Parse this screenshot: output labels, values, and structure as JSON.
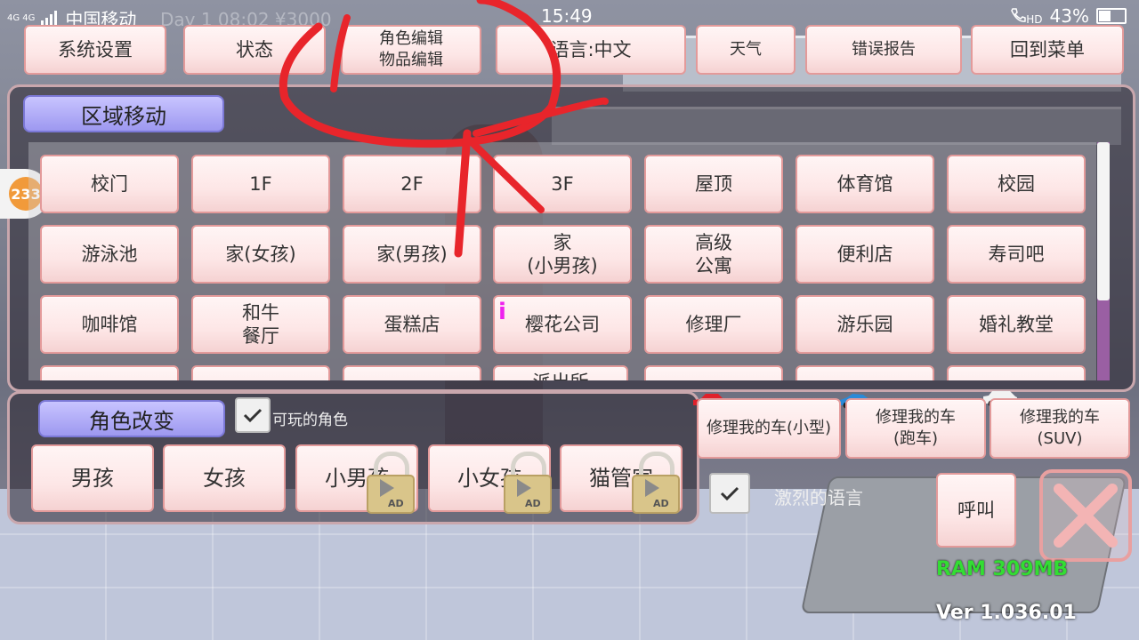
{
  "statusbar": {
    "network": "4G 4G",
    "carrier": "中国移动",
    "time": "15:49",
    "hd": "HD",
    "battery": "43%",
    "battery_level": 0.43
  },
  "background_text": "Day 1  08:02  ¥3000",
  "topbar": {
    "system_settings": "系统设置",
    "status": "状态",
    "char_edit": "角色编辑\n物品编辑",
    "language": "语言:中文",
    "weather": "天气",
    "error_report": "错误报告",
    "back_to_menu": "回到菜单"
  },
  "area_move": {
    "title": "区域移动",
    "rows": [
      [
        "校门",
        "1F",
        "2F",
        "3F",
        "屋顶",
        "体育馆",
        "校园"
      ],
      [
        "游泳池",
        "家(女孩)",
        "家(男孩)",
        "家\n(小男孩)",
        "高级\n公寓",
        "便利店",
        "寿司吧"
      ],
      [
        "咖啡馆",
        "和牛\n餐厅",
        "蛋糕店",
        "樱花公司",
        "修理厂",
        "游乐园",
        "婚礼教堂"
      ],
      [
        "",
        "",
        "",
        "派出所",
        "",
        "",
        ""
      ]
    ]
  },
  "notification_badge": "233",
  "location_marker": "i",
  "character_change": {
    "title": "角色改变",
    "playable_label": "可玩的角色",
    "playable_checked": true,
    "buttons": [
      "男孩",
      "女孩",
      "小男孩",
      "小女孩",
      "猫管家"
    ],
    "ad_label": "AD"
  },
  "cars": {
    "small": "修理我的车(小型)",
    "sport": "修理我的车\n(跑车)",
    "suv": "修理我的车\n(SUV)",
    "colors": [
      "#e0202a",
      "#2a8ad8",
      "#f2f2f2"
    ]
  },
  "harsh_language": {
    "label": "激烈的语言",
    "checked": true
  },
  "call_button": "呼叫",
  "ram": "RAM 309MB",
  "version": "Ver 1.036.01"
}
